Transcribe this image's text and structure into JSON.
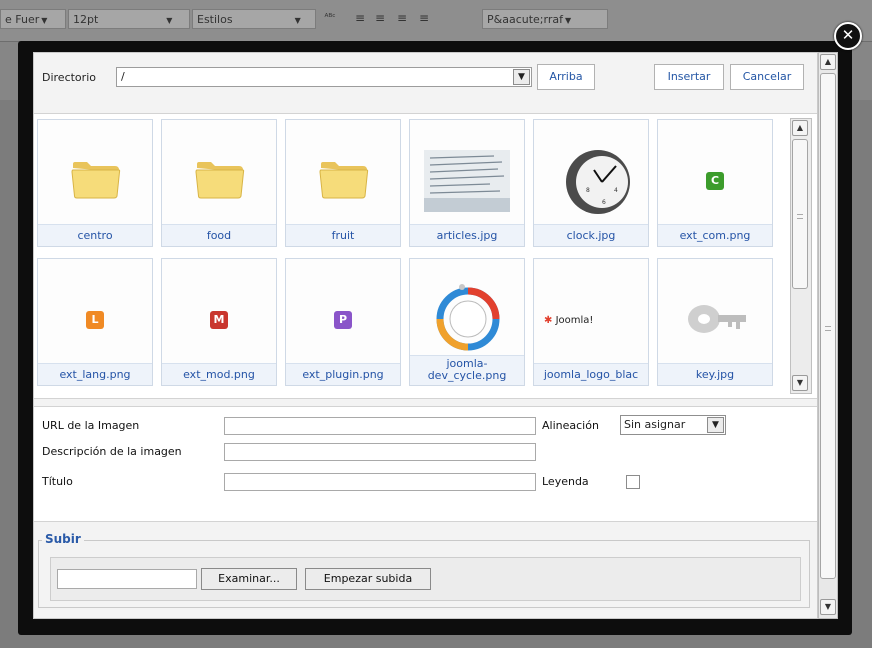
{
  "toolbar": {
    "font_family": "e Fuer",
    "font_size": "12pt",
    "styles": "Estilos",
    "paragraph": "P&aacute;rraf"
  },
  "dialog": {
    "directory_label": "Directorio",
    "directory_value": "/",
    "up_button": "Arriba",
    "insert_button": "Insertar",
    "cancel_button": "Cancelar",
    "items": [
      {
        "name": "centro",
        "kind": "folder"
      },
      {
        "name": "food",
        "kind": "folder"
      },
      {
        "name": "fruit",
        "kind": "folder"
      },
      {
        "name": "articles.jpg",
        "kind": "image"
      },
      {
        "name": "clock.jpg",
        "kind": "image"
      },
      {
        "name": "ext_com.png",
        "kind": "badge",
        "letter": "C",
        "color": "#3c9c2c"
      },
      {
        "name": "ext_lang.png",
        "kind": "badge",
        "letter": "L",
        "color": "#f08a25"
      },
      {
        "name": "ext_mod.png",
        "kind": "badge",
        "letter": "M",
        "color": "#c9362e"
      },
      {
        "name": "ext_plugin.png",
        "kind": "badge",
        "letter": "P",
        "color": "#8a55c9"
      },
      {
        "name": "joomla-dev_cycle.png",
        "kind": "image",
        "caption_lines": [
          "joomla-",
          "dev_cycle.png"
        ]
      },
      {
        "name": "joomla_logo_blac",
        "kind": "image",
        "logo_text": "Joomla!"
      },
      {
        "name": "key.jpg",
        "kind": "image"
      }
    ],
    "url_label": "URL de la Imagen",
    "description_label": "Descripción de la imagen",
    "title_label": "Título",
    "alignment_label": "Alineación",
    "alignment_value": "Sin asignar",
    "caption_label": "Leyenda",
    "upload_legend": "Subir",
    "browse_button": "Examinar...",
    "start_upload_button": "Empezar subida"
  }
}
